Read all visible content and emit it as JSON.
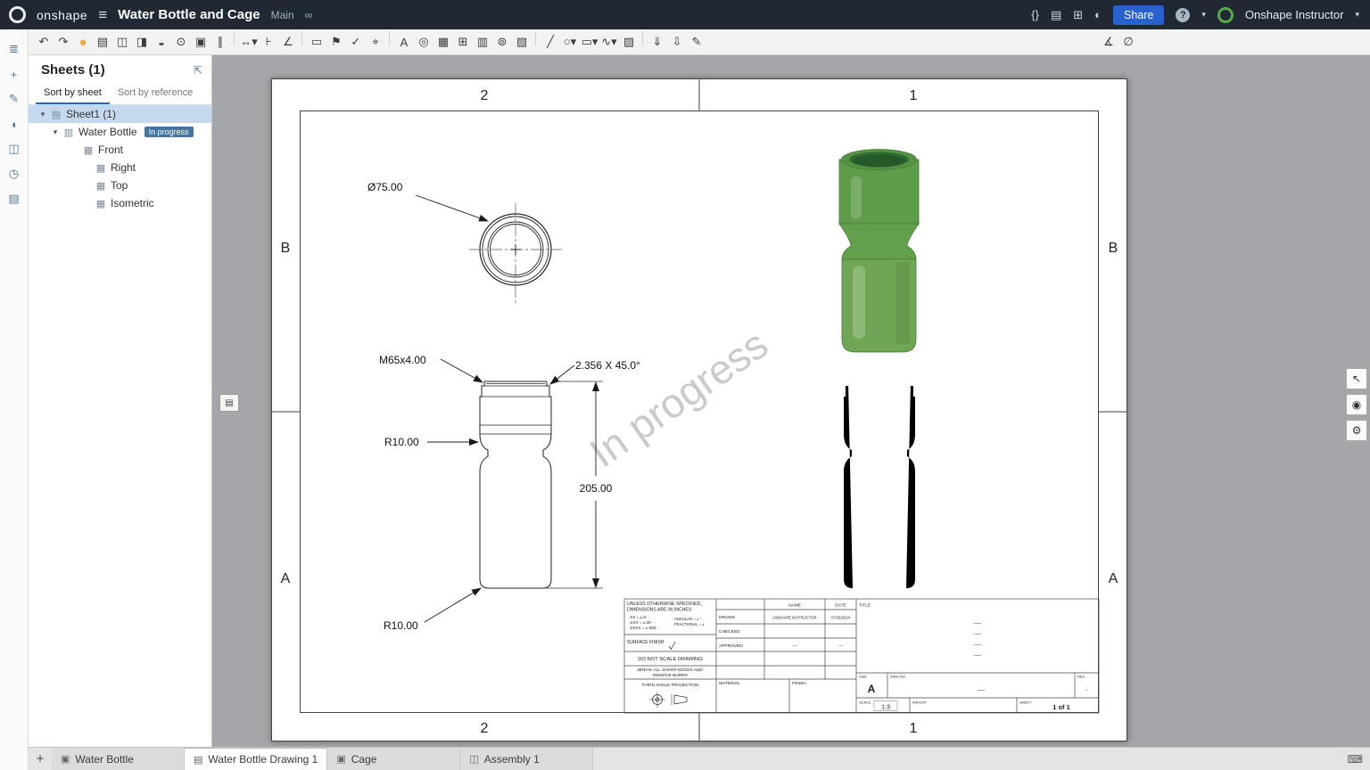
{
  "glyphs": {
    "caret": "▾",
    "hamburger": "≡",
    "link": "∞",
    "braces": "{}",
    "notebook": "▤",
    "grid": "⊞",
    "theme": "◐",
    "question": "?",
    "plus": "+",
    "popout": "⇱",
    "sheet": "▤",
    "doc": "▥",
    "view": "▦",
    "keyboard": "⌨",
    "cursor": "↖",
    "eye": "◉",
    "wrench": "⚙",
    "pages": "▤"
  },
  "topbar": {
    "logo_text": "onshape",
    "title": "Water Bottle and Cage",
    "branch": "Main",
    "share_label": "Share",
    "user_name": "Onshape Instructor"
  },
  "toolbar": {
    "icons": [
      {
        "name": "undo-icon",
        "glyph": "↶"
      },
      {
        "name": "redo-icon",
        "glyph": "↷"
      },
      {
        "name": "update-views-icon",
        "glyph": "●",
        "style": "color:#eda93c;font-size:15px"
      },
      {
        "name": "insert-view-icon",
        "glyph": "▤"
      },
      {
        "name": "projected-view-icon",
        "glyph": "◫"
      },
      {
        "name": "auxiliary-view-icon",
        "glyph": "◨"
      },
      {
        "name": "section-view-icon",
        "glyph": "◒"
      },
      {
        "name": "detail-view-icon",
        "glyph": "⊙"
      },
      {
        "name": "crop-view-icon",
        "glyph": "▣"
      },
      {
        "name": "break-view-icon",
        "glyph": "∥"
      },
      {
        "name": "divider",
        "glyph": "",
        "style": "min-width:0;width:1px;height:16px;border-left:1px solid #cfcfcf;margin:0 4px"
      },
      {
        "name": "dimension-icon",
        "glyph": "↔▾"
      },
      {
        "name": "ordinate-dimension-icon",
        "glyph": "⊦"
      },
      {
        "name": "chamfer-dimension-icon",
        "glyph": "∠"
      },
      {
        "name": "divider",
        "glyph": "",
        "style": "min-width:0;width:1px;height:16px;border-left:1px solid #cfcfcf;margin:0 4px"
      },
      {
        "name": "note-icon",
        "glyph": "▭"
      },
      {
        "name": "label-icon",
        "glyph": "⚑"
      },
      {
        "name": "surface-finish-icon",
        "glyph": "✓"
      },
      {
        "name": "geometric-tolerance-icon",
        "glyph": "⌖"
      },
      {
        "name": "divider",
        "glyph": "",
        "style": "min-width:0;width:1px;height:16px;border-left:1px solid #cfcfcf;margin:0 4px"
      },
      {
        "name": "text-icon",
        "glyph": "A"
      },
      {
        "name": "zoom-search-icon",
        "glyph": "◎"
      },
      {
        "name": "table-icon",
        "glyph": "▦"
      },
      {
        "name": "hole-table-icon",
        "glyph": "⊞"
      },
      {
        "name": "bom-table-icon",
        "glyph": "▥"
      },
      {
        "name": "balloon-icon",
        "glyph": "⊚"
      },
      {
        "name": "revision-table-icon",
        "glyph": "▧"
      },
      {
        "name": "divider",
        "glyph": "",
        "style": "min-width:0;width:1px;height:16px;border-left:1px solid #cfcfcf;margin:0 4px"
      },
      {
        "name": "line-icon",
        "glyph": "╱"
      },
      {
        "name": "circle-icon",
        "glyph": "○▾"
      },
      {
        "name": "rectangle-icon",
        "glyph": "▭▾"
      },
      {
        "name": "spline-icon",
        "glyph": "∿▾"
      },
      {
        "name": "hatch-icon",
        "glyph": "▨"
      },
      {
        "name": "divider",
        "glyph": "",
        "style": "min-width:0;width:1px;height:16px;border-left:1px solid #cfcfcf;margin:0 4px"
      },
      {
        "name": "export-dxf-icon",
        "glyph": "⇓"
      },
      {
        "name": "export-pdf-icon",
        "glyph": "⇩"
      },
      {
        "name": "sketch-pencil-icon",
        "glyph": "✎"
      }
    ],
    "right_icons": [
      {
        "name": "measure-icon",
        "glyph": "∡"
      },
      {
        "name": "clear-measure-icon",
        "glyph": "∅"
      }
    ]
  },
  "rail": {
    "icons": [
      {
        "name": "feature-panel-icon",
        "glyph": "≣"
      },
      {
        "name": "insert-icon",
        "glyph": "+"
      },
      {
        "name": "appearance-icon",
        "glyph": "✎"
      },
      {
        "name": "comment-icon",
        "glyph": "◖"
      },
      {
        "name": "parts-icon",
        "glyph": "◫"
      },
      {
        "name": "history-icon",
        "glyph": "◷"
      },
      {
        "name": "notes-icon",
        "glyph": "▤"
      }
    ]
  },
  "sheets_panel": {
    "title": "Sheets (1)",
    "tab_sheet": "Sort by sheet",
    "tab_reference": "Sort by reference",
    "sheet1_label": "Sheet1 (1)",
    "part_label": "Water Bottle",
    "badge": "In progress",
    "front_label": "Front",
    "views": [
      {
        "label": "Right",
        "glyph": "▦"
      },
      {
        "label": "Top",
        "glyph": "▦"
      },
      {
        "label": "Isometric",
        "glyph": "▦"
      }
    ]
  },
  "drawing": {
    "watermark": "In progress",
    "zones": {
      "z2": "2",
      "z1": "1",
      "zb": "B",
      "za": "A"
    },
    "dimensions": {
      "diameter": "Ø75.00",
      "thread": "M65x4.00",
      "chamfer": "2.356 X 45.0°",
      "radius_top": "R10.00",
      "height": "205.00",
      "radius_bottom": "R10.00"
    }
  },
  "titleblock": {
    "note1": "UNLESS OTHERWISE SPECIFIED,",
    "note2": "DIMENSIONS ARE IN INCHES",
    "tol1": ".XX = ±.0-",
    "tol2": ".XXX = ±.00-",
    "tol3": ".XXXX = ±.000-",
    "tol4": "ANGULAR = ± °",
    "tol5": "FRACTIONAL = ±",
    "surface_finish": "SURFACE FINISH",
    "do_not_scale": "DO NOT SCALE DRAWING",
    "break_edges1": "BREAK ALL SHARP EDGES AND",
    "break_edges2": "REMOVE BURRS",
    "third_angle": "THIRD ANGLE PROJECTION",
    "name_header": "NAME",
    "date_header": "DATE",
    "drawn": "DRAWN",
    "drawn_name": "ONSHAPE INSTRUCTOR",
    "drawn_date": "07/26/2024",
    "checked": "CHECKED",
    "approved": "APPROVED",
    "approved_name": "—",
    "approved_date": "—",
    "material": "MATERIAL",
    "finish": "FINISH",
    "title_label": "TITLE",
    "title_line": "----",
    "size_label": "SIZE",
    "size_value": "A",
    "dwg_label": "DWG NO.",
    "dwg_value": "----",
    "rev_label": "REV.",
    "rev_value": "-",
    "scale_label": "SCALE",
    "scale_value": "1:3",
    "weight_label": "WEIGHT",
    "sheet_label": "SHEET",
    "sheet_value": "1 of 1"
  },
  "tabs": {
    "items": [
      {
        "label": "Water Bottle",
        "glyph": "▣"
      },
      {
        "label": "Water Bottle Drawing 1",
        "glyph": "▤"
      },
      {
        "label": "Cage",
        "glyph": "▣"
      },
      {
        "label": "Assembly 1",
        "glyph": "◫"
      }
    ]
  }
}
